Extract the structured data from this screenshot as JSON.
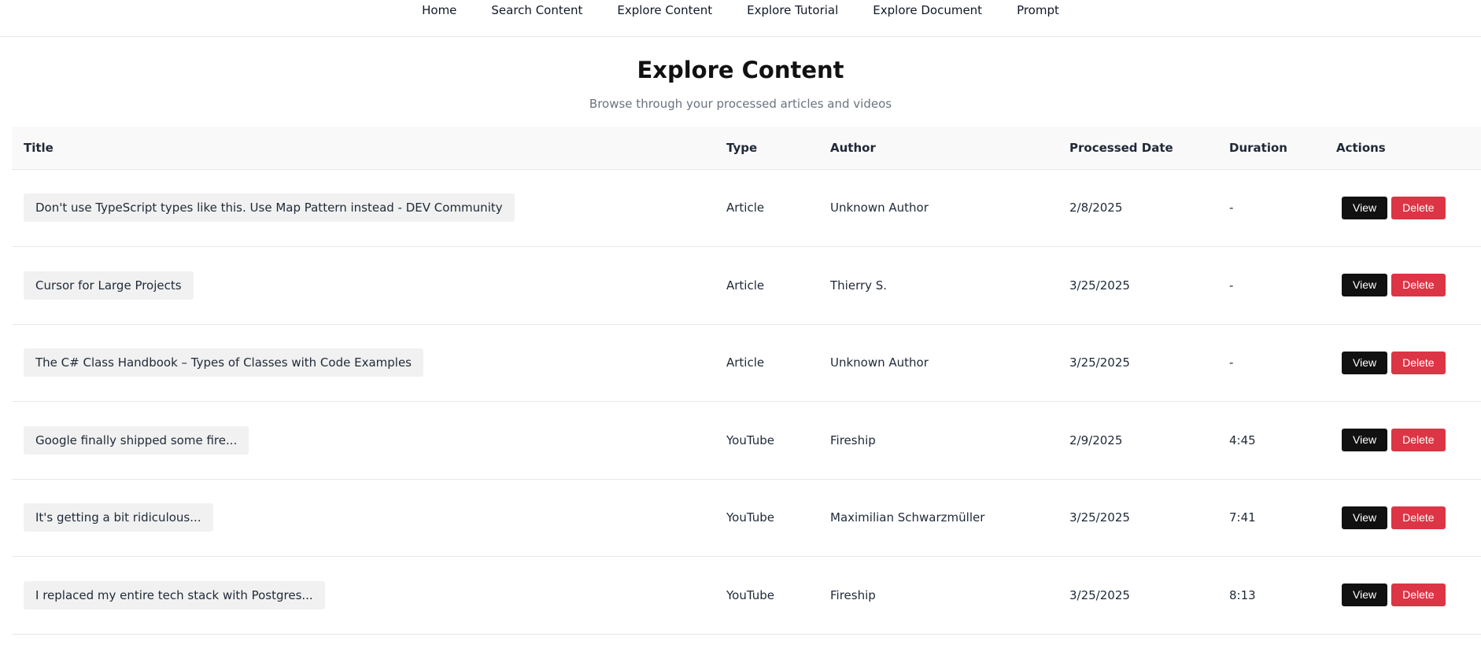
{
  "nav": {
    "items": [
      "Home",
      "Search Content",
      "Explore Content",
      "Explore Tutorial",
      "Explore Document",
      "Prompt"
    ]
  },
  "header": {
    "title": "Explore Content",
    "subtitle": "Browse through your processed articles and videos"
  },
  "table": {
    "columns": [
      "Title",
      "Type",
      "Author",
      "Processed Date",
      "Duration",
      "Actions"
    ],
    "view_label": "View",
    "delete_label": "Delete",
    "rows": [
      {
        "title": "Don't use TypeScript types like this. Use Map Pattern instead - DEV Community",
        "type": "Article",
        "author": "Unknown Author",
        "date": "2/8/2025",
        "duration": "-"
      },
      {
        "title": "Cursor for Large Projects",
        "type": "Article",
        "author": "Thierry S.",
        "date": "3/25/2025",
        "duration": "-"
      },
      {
        "title": "The C# Class Handbook – Types of Classes with Code Examples",
        "type": "Article",
        "author": "Unknown Author",
        "date": "3/25/2025",
        "duration": "-"
      },
      {
        "title": "Google finally shipped some fire...",
        "type": "YouTube",
        "author": "Fireship",
        "date": "2/9/2025",
        "duration": "4:45"
      },
      {
        "title": "It's getting a bit ridiculous...",
        "type": "YouTube",
        "author": "Maximilian Schwarzmüller",
        "date": "3/25/2025",
        "duration": "7:41"
      },
      {
        "title": "I replaced my entire tech stack with Postgres...",
        "type": "YouTube",
        "author": "Fireship",
        "date": "3/25/2025",
        "duration": "8:13"
      }
    ]
  },
  "colors": {
    "view_button": "#111111",
    "delete_button": "#dc3545",
    "header_row": "#f9f9f9",
    "title_chip": "#f1f1f1"
  }
}
